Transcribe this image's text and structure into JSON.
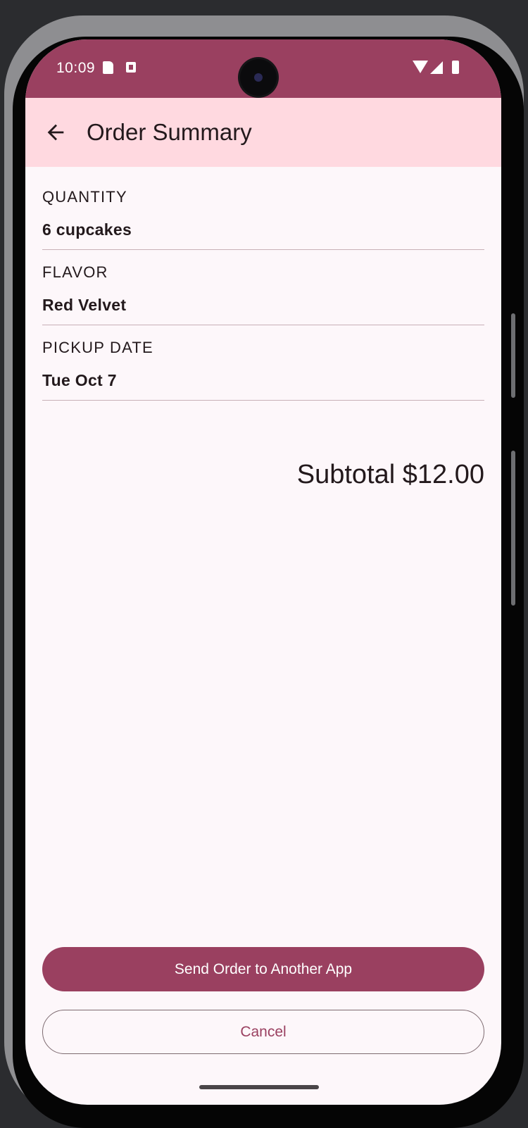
{
  "status_bar": {
    "time": "10:09",
    "icons": [
      "sd-card-icon",
      "notification-a-icon",
      "wifi-icon",
      "signal-icon",
      "battery-icon"
    ],
    "color": "#9a4060"
  },
  "app_bar": {
    "title": "Order Summary",
    "back_icon": "arrow-left-icon",
    "color": "#ffd9e0"
  },
  "summary": {
    "fields": [
      {
        "label": "QUANTITY",
        "value": "6 cupcakes"
      },
      {
        "label": "FLAVOR",
        "value": "Red Velvet"
      },
      {
        "label": "PICKUP DATE",
        "value": "Tue Oct 7"
      }
    ],
    "subtotal": "Subtotal $12.00"
  },
  "actions": {
    "send_label": "Send Order to Another App",
    "cancel_label": "Cancel",
    "accent": "#9a4060"
  }
}
